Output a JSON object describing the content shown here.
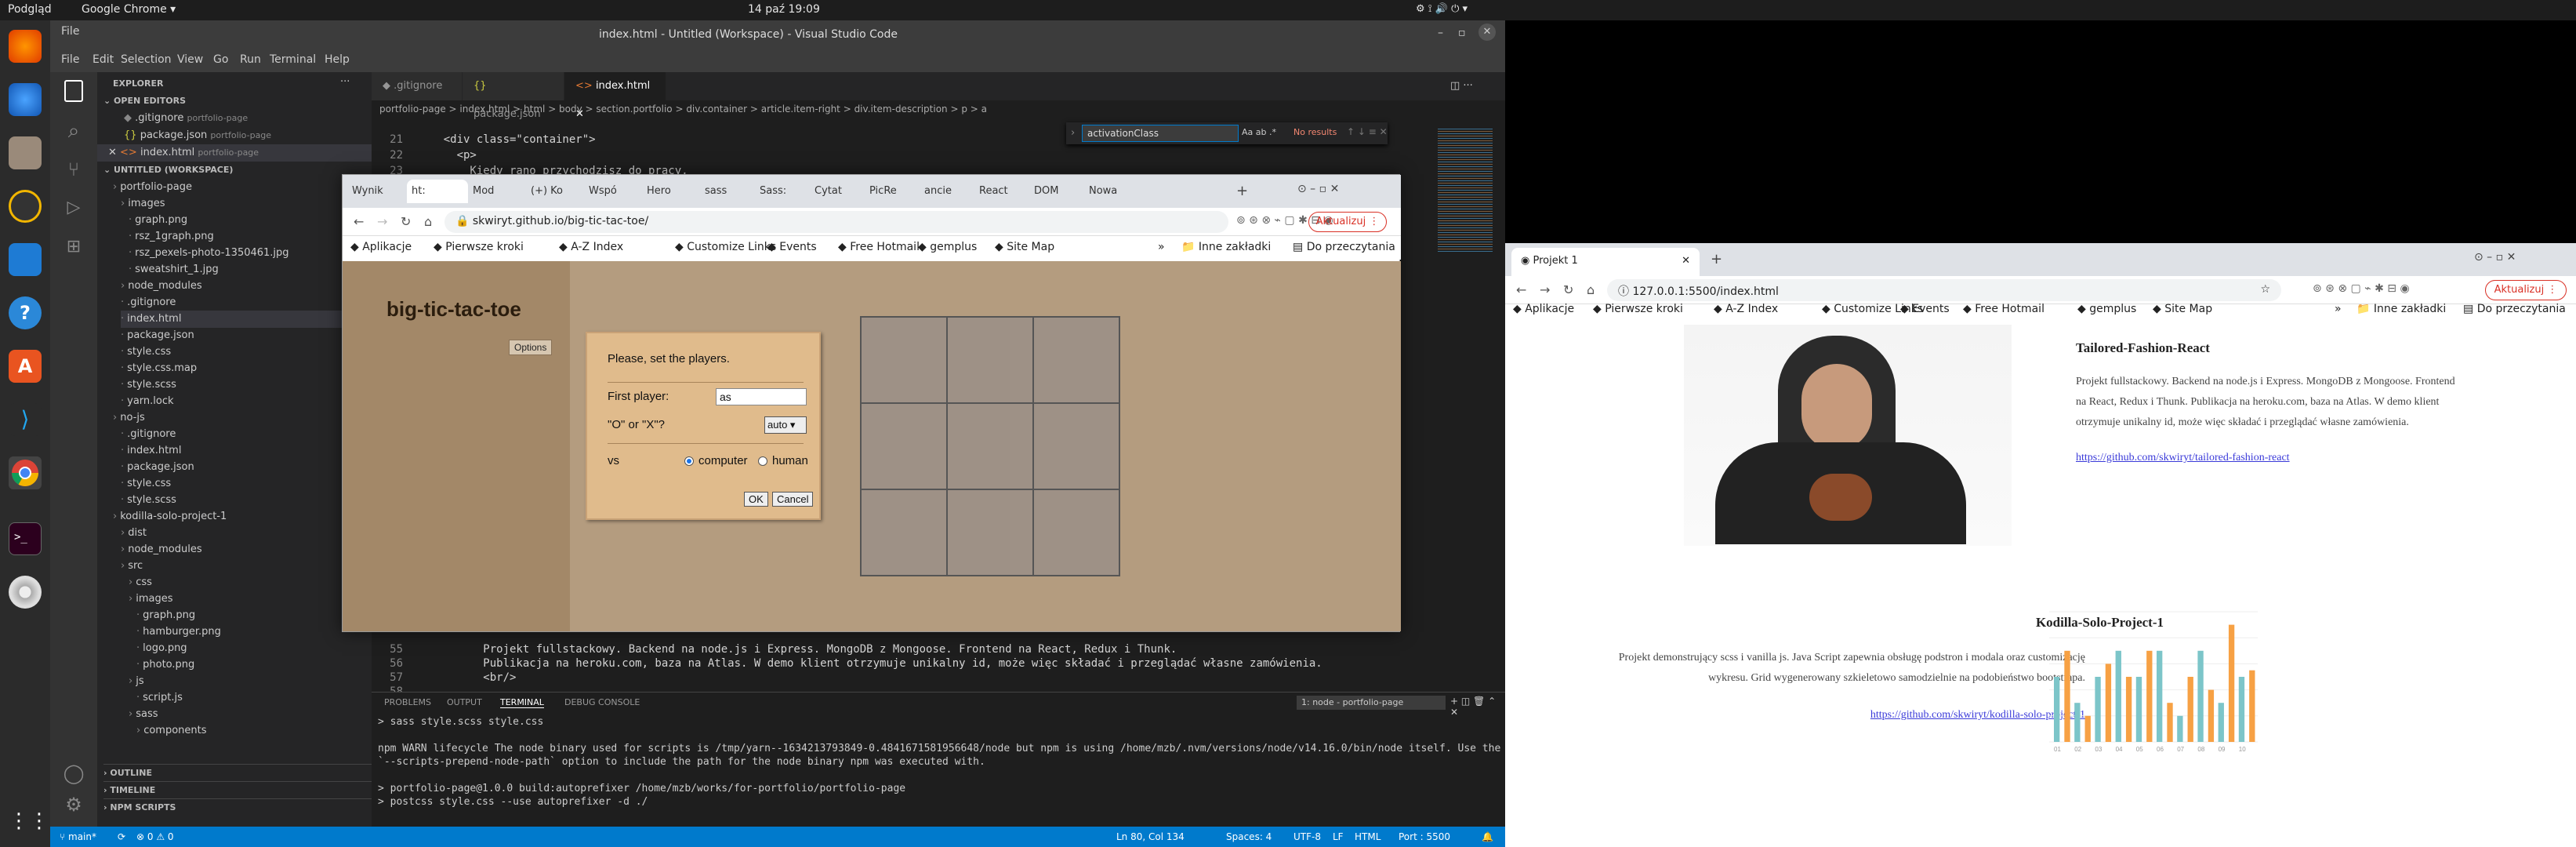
{
  "topbar": {
    "app": "Podgląd",
    "browser": "Google Chrome",
    "datetime": "14 paź 19:09"
  },
  "dock": {
    "icons": [
      "firefox-icon",
      "thunderbird-icon",
      "files-icon",
      "rhythmbox-icon",
      "libreoffice-icon",
      "help-icon",
      "software-icon",
      "vscode-icon",
      "chrome-icon",
      "terminal-icon",
      "dvd-icon",
      "apps-grid-icon"
    ]
  },
  "vscode": {
    "title": "index.html - Untitled (Workspace) - Visual Studio Code",
    "menu": [
      "File",
      "Edit",
      "Selection",
      "View",
      "Go",
      "Run",
      "Terminal",
      "Help"
    ],
    "explorer_label": "EXPLORER",
    "open_editors_label": "OPEN EDITORS",
    "open_editors": [
      {
        "name": ".gitignore",
        "path": "portfolio-page"
      },
      {
        "name": "package.json",
        "path": "portfolio-page"
      },
      {
        "name": "index.html",
        "path": "portfolio-page"
      }
    ],
    "workspace_label": "UNTITLED (WORKSPACE)",
    "tree": [
      "portfolio-page",
      "images",
      "graph.png",
      "rsz_1graph.png",
      "rsz_pexels-photo-1350461.jpg",
      "sweatshirt_1.jpg",
      "node_modules",
      ".gitignore",
      "index.html",
      "package.json",
      "style.css",
      "style.css.map",
      "style.scss",
      "yarn.lock",
      "no-js",
      ".gitignore",
      "index.html",
      "package.json",
      "style.css",
      "style.scss",
      "kodilla-solo-project-1",
      "dist",
      "node_modules",
      "src",
      "css",
      "images",
      "graph.png",
      "hamburger.png",
      "logo.png",
      "photo.png",
      "js",
      "script.js",
      "sass",
      "components"
    ],
    "outline_label": "OUTLINE",
    "timeline_label": "TIMELINE",
    "npm_label": "NPM SCRIPTS",
    "tabs": [
      ".gitignore",
      "package.json",
      "index.html"
    ],
    "breadcrumb": "portfolio-page > index.html > html > body > section.portfolio > div.container > article.item-right > div.item-description > p > a",
    "find": {
      "value": "activationClass",
      "result": "No results"
    },
    "code_top": [
      {
        "n": "21",
        "t": "    <div class=\"container\">"
      },
      {
        "n": "22",
        "t": "      <p>"
      },
      {
        "n": "23",
        "t": "        Kiedy rano przychodzisz do pracy,"
      }
    ],
    "code_bottom": [
      {
        "n": "55",
        "t": "          Projekt fullstackowy. Backend na node.js i Express. MongoDB z Mongoose. Frontend na React, Redux i Thunk."
      },
      {
        "n": "56",
        "t": "          Publikacja na heroku.com, baza na Atlas. W demo klient otrzymuje unikalny id, może więc składać i przeglądać własne zamówienia."
      },
      {
        "n": "57",
        "t": "          <br/>"
      },
      {
        "n": "58",
        "t": ""
      }
    ],
    "panel_tabs": [
      "PROBLEMS",
      "OUTPUT",
      "TERMINAL",
      "DEBUG CONSOLE"
    ],
    "terminal_select": "1: node - portfolio-page",
    "terminal": [
      "> sass style.scss style.css",
      "",
      "npm WARN lifecycle The node binary used for scripts is /tmp/yarn--1634213793849-0.4841671581956648/node but npm is using /home/mzb/.nvm/versions/node/v14.16.0/bin/node itself. Use the",
      "`--scripts-prepend-node-path` option to include the path for the node binary npm was executed with.",
      "",
      "> portfolio-page@1.0.0 build:autoprefixer /home/mzb/works/for-portfolio/portfolio-page",
      "> postcss style.css --use autoprefixer -d ./"
    ],
    "status": {
      "branch": "main*",
      "errors": "⊗ 0 ⚠ 0",
      "position": "Ln 80, Col 134",
      "spaces": "Spaces: 4",
      "encoding": "UTF-8",
      "eol": "LF",
      "lang": "HTML",
      "port": "Port : 5500"
    }
  },
  "chrome1": {
    "tabs": [
      "Wynik",
      "ht:",
      "Mod",
      "(+) Ko",
      "Wspó",
      "Hero",
      "sass",
      "Sass:",
      "Cytat",
      "PicRe",
      "ancie",
      "React",
      "DOM",
      "Nowa"
    ],
    "url": "skwiryt.github.io/big-tic-tac-toe/",
    "update_label": "Aktualizuj",
    "bookmarks": [
      "Aplikacje",
      "Pierwsze kroki",
      "A-Z Index",
      "Customize Links",
      "Events",
      "Free Hotmail",
      "gemplus",
      "Site Map"
    ],
    "other_bookmarks": "Inne zakładki",
    "reading_list": "Do przeczytania",
    "game": {
      "title": "big-tic-tac-toe",
      "options_label": "Options",
      "dialog_title": "Please, set the players.",
      "first_player_label": "First player:",
      "first_player_value": "as",
      "o_or_x_label": "\"O\" or \"X\"?",
      "o_or_x_value": "auto",
      "vs_label": "vs",
      "computer_label": "computer",
      "human_label": "human",
      "ok_label": "OK",
      "cancel_label": "Cancel"
    }
  },
  "chrome2": {
    "tab": "Projekt 1",
    "url": "127.0.0.1:5500/index.html",
    "update_label": "Aktualizuj",
    "bookmarks": [
      "Aplikacje",
      "Pierwsze kroki",
      "A-Z Index",
      "Customize Links",
      "Events",
      "Free Hotmail",
      "gemplus",
      "Site Map"
    ],
    "other_bookmarks": "Inne zakładki",
    "reading_list": "Do przeczytania",
    "project1": {
      "title": "Tailored-Fashion-React",
      "desc": "Projekt fullstackowy. Backend na node.js i Express. MongoDB z Mongoose. Frontend na React, Redux i Thunk. Publikacja na heroku.com, baza na Atlas. W demo klient otrzymuje unikalny id, może więc składać i przeglądać własne zamówienia.",
      "link": "https://github.com/skwiryt/tailored-fashion-react"
    },
    "project2": {
      "title": "Kodilla-Solo-Project-1",
      "desc": "Projekt demonstrujący scss i vanilla js. Java Script zapewnia obsługę podstron i modala oraz customizację wykresu. Grid wygenerowany szkieletowo samodzielnie na podobieństwo bootstrapa.",
      "link": "https://github.com/skwiryt/kodilla-solo-project-1"
    }
  },
  "chart_data": {
    "type": "bar",
    "categories": [
      "01",
      "02",
      "03",
      "04",
      "05",
      "06",
      "07",
      "08",
      "09",
      "10"
    ],
    "series": [
      {
        "values": [
          5,
          3,
          5,
          7,
          5,
          7,
          2,
          7,
          3,
          5
        ]
      },
      {
        "values": [
          7,
          2,
          6,
          5,
          7,
          3,
          5,
          4,
          9,
          5.5
        ]
      }
    ],
    "ylim": [
      0,
      10
    ],
    "colors": [
      "#7cc5c9",
      "#f7a144"
    ]
  }
}
